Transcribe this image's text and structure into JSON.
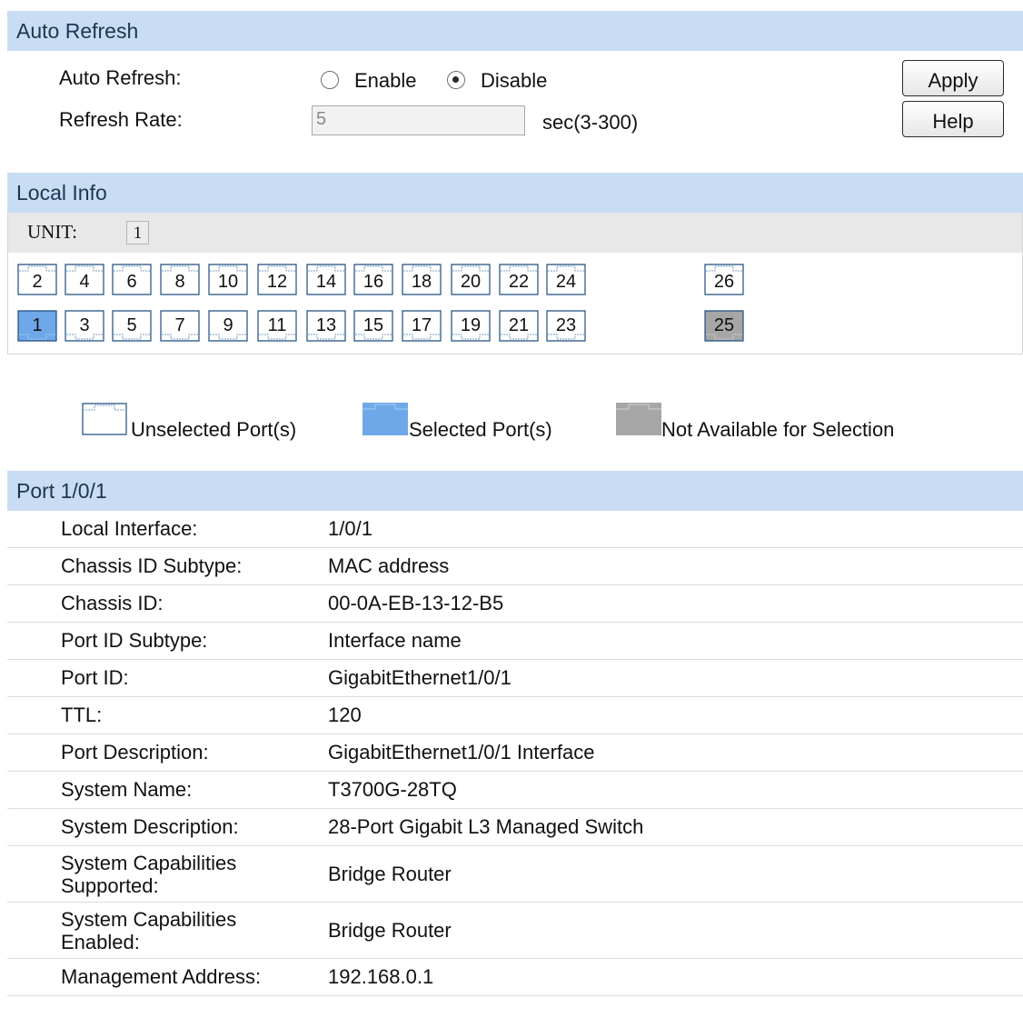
{
  "auto_refresh": {
    "header": "Auto Refresh",
    "auto_refresh_label": "Auto Refresh:",
    "enable_label": "Enable",
    "disable_label": "Disable",
    "selected": "Disable",
    "refresh_rate_label": "Refresh Rate:",
    "refresh_rate_value": "5",
    "refresh_rate_unit": "sec(3-300)",
    "apply_button": "Apply",
    "help_button": "Help"
  },
  "local_info": {
    "header": "Local Info",
    "unit_label": "UNIT:",
    "unit_value": "1",
    "ports_top": [
      "2",
      "4",
      "6",
      "8",
      "10",
      "12",
      "14",
      "16",
      "18",
      "20",
      "22",
      "24",
      "26"
    ],
    "ports_bottom": [
      "1",
      "3",
      "5",
      "7",
      "9",
      "11",
      "13",
      "15",
      "17",
      "19",
      "21",
      "23",
      "25"
    ],
    "selected_port": "1",
    "unavailable_port": "25",
    "legend": {
      "unselected": "Unselected Port(s)",
      "selected": "Selected Port(s)",
      "unavailable": "Not Available for Selection"
    },
    "colors": {
      "selected": "#6fa8e8",
      "unavailable": "#a6a6a6",
      "unselected": "#ffffff",
      "outline": "#1f4e7f"
    }
  },
  "port_info": {
    "header": "Port 1/0/1",
    "rows": [
      {
        "key": "Local Interface:",
        "value": "1/0/1"
      },
      {
        "key": "Chassis ID Subtype:",
        "value": "MAC address"
      },
      {
        "key": "Chassis ID:",
        "value": "00-0A-EB-13-12-B5"
      },
      {
        "key": "Port ID Subtype:",
        "value": "Interface name"
      },
      {
        "key": "Port ID:",
        "value": "GigabitEthernet1/0/1"
      },
      {
        "key": "TTL:",
        "value": "120"
      },
      {
        "key": "Port Description:",
        "value": "GigabitEthernet1/0/1 Interface"
      },
      {
        "key": "System Name:",
        "value": "T3700G-28TQ"
      },
      {
        "key": "System Description:",
        "value": "28-Port Gigabit L3 Managed Switch"
      },
      {
        "key": "System Capabilities Supported:",
        "value": "Bridge Router"
      },
      {
        "key": "System Capabilities Enabled:",
        "value": "Bridge Router"
      },
      {
        "key": "Management Address:",
        "value": "192.168.0.1"
      }
    ]
  }
}
